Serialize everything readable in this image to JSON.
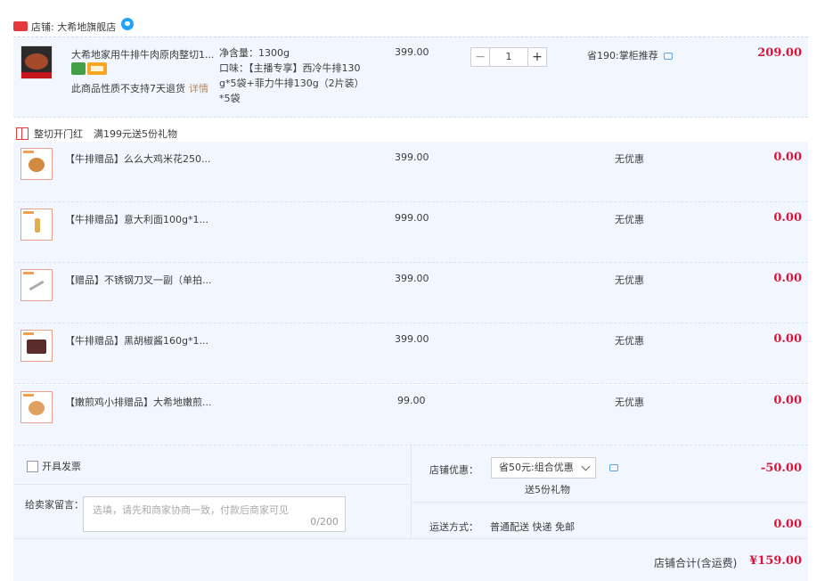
{
  "store": {
    "name": "店铺: 大希地旗舰店",
    "badge_text": "天猫",
    "accent": "#e4393c"
  },
  "main_item": {
    "title": "大希地家用牛排牛肉原肉整切1...",
    "notice": "此商品性质不支持7天退货",
    "detail_link": "详情",
    "spec_lines": [
      "净含量：1300g",
      "口味：【主播专享】西冷牛排130",
      "g*5袋+菲力牛排130g（2片装）",
      "*5袋"
    ],
    "unit_price": "399.00",
    "quantity": "1",
    "quantity_minus": "−",
    "quantity_plus": "+",
    "promo": "省190:掌柜推荐",
    "total": "209.00"
  },
  "gift_section": {
    "label": "整切开门红",
    "rule": "满199元送5份礼物"
  },
  "gifts": [
    {
      "title": "【牛排赠品】么么大鸡米花250...",
      "price": "399.00",
      "discount": "无优惠",
      "total": "0.00"
    },
    {
      "title": "【牛排赠品】意大利面100g*1...",
      "price": "999.00",
      "discount": "无优惠",
      "total": "0.00"
    },
    {
      "title": "【赠品】不锈钢刀叉一副（单拍...",
      "price": "399.00",
      "discount": "无优惠",
      "total": "0.00"
    },
    {
      "title": "【牛排赠品】黑胡椒酱160g*1...",
      "price": "399.00",
      "discount": "无优惠",
      "total": "0.00"
    },
    {
      "title": "【嫩煎鸡小排赠品】大希地嫩煎...",
      "price": "99.00",
      "discount": "无优惠",
      "total": "0.00"
    }
  ],
  "footer": {
    "invoice_label": "开具发票",
    "message_label": "给卖家留言：",
    "message_placeholder": "选填，请先和商家协商一致，付款后商家可见",
    "message_count": "0/200",
    "store_discount_label": "店铺优惠：",
    "store_discount_selected": "省50元:组合优惠",
    "gift_count_text": "送5份礼物",
    "store_discount_value": "-50.00",
    "shipping_label": "运送方式：",
    "shipping_value": "普通配送 快递 免邮",
    "shipping_cost": "0.00",
    "sum_label": "店铺合计(含运费)",
    "sum_value": "¥159.00"
  },
  "colors": {
    "price_red": "#d9163a",
    "row_bg": "#f2f7ff",
    "link_brown": "#b58a5a"
  }
}
